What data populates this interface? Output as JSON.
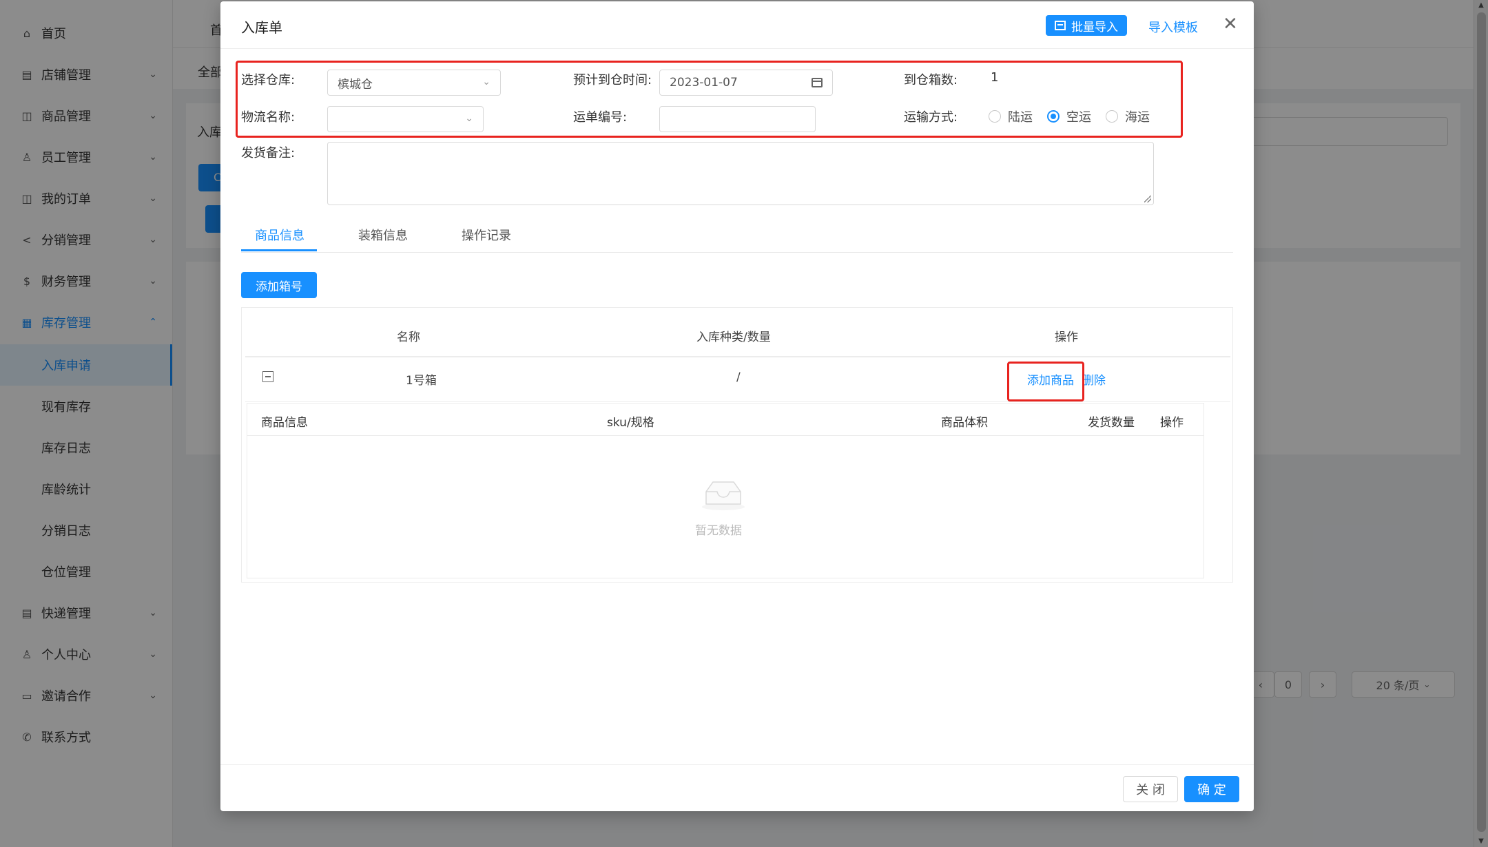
{
  "sidebar": {
    "items": [
      {
        "label": "首页",
        "icon": "home-icon"
      },
      {
        "label": "店铺管理",
        "icon": "shop-icon"
      },
      {
        "label": "商品管理",
        "icon": "bag-icon"
      },
      {
        "label": "员工管理",
        "icon": "users-icon"
      },
      {
        "label": "我的订单",
        "icon": "order-icon"
      },
      {
        "label": "分销管理",
        "icon": "share-icon"
      },
      {
        "label": "财务管理",
        "icon": "finance-icon"
      },
      {
        "label": "库存管理",
        "icon": "table-icon"
      },
      {
        "label": "入库申请"
      },
      {
        "label": "现有库存"
      },
      {
        "label": "库存日志"
      },
      {
        "label": "库龄统计"
      },
      {
        "label": "分销日志"
      },
      {
        "label": "仓位管理"
      },
      {
        "label": "快递管理",
        "icon": "express-icon"
      },
      {
        "label": "个人中心",
        "icon": "user-icon"
      },
      {
        "label": "邀请合作",
        "icon": "invite-icon"
      },
      {
        "label": "联系方式",
        "icon": "phone-icon"
      }
    ]
  },
  "background": {
    "header_fragment": "首",
    "tab_fragment": "全部",
    "panel_fragment": "入库",
    "btn_fragment": "C",
    "page_number": "0",
    "page_size": "20 条/页"
  },
  "modal": {
    "title": "入库单",
    "batch_import": "批量导入",
    "import_template": "导入模板",
    "close_symbol": "✕",
    "form": {
      "warehouse_label": "选择仓库:",
      "warehouse_value": "槟城仓",
      "eta_label": "预计到仓时间:",
      "eta_value": "2023-01-07",
      "box_count_label": "到仓箱数:",
      "box_count_value": "1",
      "logistics_label": "物流名称:",
      "logistics_value": "",
      "waybill_label": "运单编号:",
      "waybill_value": "",
      "transport_label": "运输方式:",
      "transport_options": [
        "陆运",
        "空运",
        "海运"
      ],
      "transport_selected": "空运",
      "remark_label": "发货备注:",
      "remark_value": ""
    },
    "tabs": [
      "商品信息",
      "装箱信息",
      "操作记录"
    ],
    "add_box_button": "添加箱号",
    "table": {
      "headers": [
        "名称",
        "入库种类/数量",
        "操作"
      ],
      "rows": [
        {
          "name": "1号箱",
          "kinds": "/",
          "actions": [
            "添加商品",
            "删除"
          ]
        }
      ],
      "inner_headers": [
        "商品信息",
        "sku/规格",
        "商品体积",
        "发货数量",
        "操作"
      ],
      "empty_text": "暂无数据"
    },
    "footer": {
      "close": "关 闭",
      "confirm": "确 定"
    }
  },
  "colors": {
    "primary": "#1890ff",
    "highlight": "#e8231f"
  }
}
